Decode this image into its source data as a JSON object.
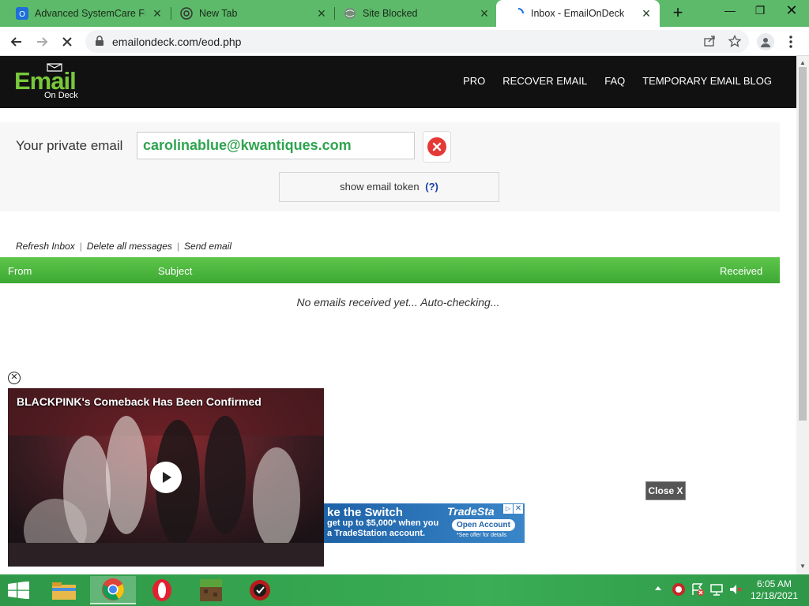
{
  "browser": {
    "tabs": [
      {
        "label": "Advanced SystemCare Free",
        "active": false
      },
      {
        "label": "New Tab",
        "active": false
      },
      {
        "label": "Site Blocked",
        "active": false
      },
      {
        "label": "Inbox - EmailOnDeck",
        "active": true
      }
    ],
    "url": "emailondeck.com/eod.php"
  },
  "site": {
    "logo_main": "Email",
    "logo_sub": "On Deck",
    "nav": [
      "PRO",
      "RECOVER EMAIL",
      "FAQ",
      "TEMPORARY EMAIL BLOG"
    ]
  },
  "email_panel": {
    "label": "Your private email",
    "address": "carolinablue@kwantiques.com",
    "token_button": "show email token",
    "token_help": "(?)"
  },
  "inbox": {
    "actions": [
      "Refresh Inbox",
      "Delete all messages",
      "Send email"
    ],
    "columns": {
      "from": "From",
      "subject": "Subject",
      "received": "Received"
    },
    "empty_message": "No emails received yet... Auto-checking..."
  },
  "video_ad": {
    "title": "BLACKPINK's Comeback Has Been Confirmed"
  },
  "banner_ad": {
    "headline": "ke the Switch",
    "line1": "get up to $5,000* when you",
    "line2": "a TradeStation account.",
    "brand": "TradeSta",
    "button": "Open Account",
    "fine_print": "*See offer for details"
  },
  "close_ad_button": "Close X",
  "taskbar": {
    "time": "6:05 AM",
    "date": "12/18/2021"
  },
  "colors": {
    "tabstrip": "#5dba6a",
    "header_bg": "#111111",
    "logo_green": "#78c83a",
    "email_green": "#2ea44f",
    "inbox_header": "#3da934",
    "taskbar": "#3aad55"
  }
}
